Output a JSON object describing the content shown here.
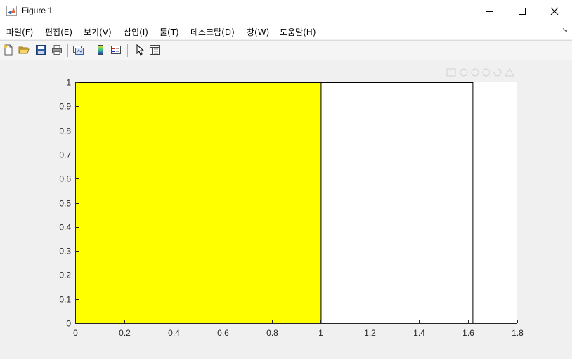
{
  "window": {
    "title": "Figure 1",
    "icon": "matlab-logo-icon"
  },
  "menu": [
    {
      "label": "파일(F)"
    },
    {
      "label": "편집(E)"
    },
    {
      "label": "보기(V)"
    },
    {
      "label": "삽입(I)"
    },
    {
      "label": "툴(T)"
    },
    {
      "label": "데스크탑(D)"
    },
    {
      "label": "창(W)"
    },
    {
      "label": "도움말(H)"
    }
  ],
  "toolbar": {
    "items": [
      "new-figure-icon",
      "open-file-icon",
      "save-icon",
      "print-icon",
      "link-plot-icon",
      "insert-colorbar-icon",
      "insert-legend-icon",
      "edit-plot-cursor-icon",
      "property-inspector-icon"
    ]
  },
  "colors": {
    "bar_fill": "#ffff00",
    "bar_edge": "#000000",
    "axes_bg": "#ffffff",
    "figure_bg": "#f0f0f0"
  },
  "chart_data": {
    "type": "bar",
    "title": "",
    "xlabel": "",
    "ylabel": "",
    "xlim": [
      0,
      1.8
    ],
    "ylim": [
      0,
      1
    ],
    "xticks": [
      "0",
      "0.2",
      "0.4",
      "0.6",
      "0.8",
      "1",
      "1.2",
      "1.4",
      "1.6",
      "1.8"
    ],
    "yticks": [
      "0",
      "0.1",
      "0.2",
      "0.3",
      "0.4",
      "0.5",
      "0.6",
      "0.7",
      "0.8",
      "0.9",
      "1"
    ],
    "rects": [
      {
        "x0": 0,
        "x1": 1,
        "y0": 0,
        "y1": 1,
        "fill": "#ffff00"
      },
      {
        "x0": 1,
        "x1": 1.618,
        "y0": 0,
        "y1": 1,
        "fill": "#ffffff"
      }
    ],
    "grid": false
  }
}
